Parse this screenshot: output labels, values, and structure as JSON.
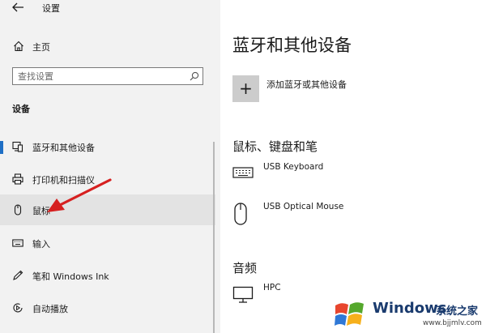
{
  "window": {
    "title": "设置"
  },
  "sidebar": {
    "home_label": "主页",
    "search": {
      "placeholder": "查找设置"
    },
    "section_label": "设备",
    "items": [
      {
        "label": "蓝牙和其他设备",
        "icon": "bluetooth-devices-icon",
        "active": true
      },
      {
        "label": "打印机和扫描仪",
        "icon": "printer-icon",
        "active": false
      },
      {
        "label": "鼠标",
        "icon": "mouse-icon",
        "active": false,
        "hovered": true
      },
      {
        "label": "输入",
        "icon": "keyboard-icon",
        "active": false
      },
      {
        "label": "笔和 Windows Ink",
        "icon": "pen-icon",
        "active": false
      },
      {
        "label": "自动播放",
        "icon": "autoplay-icon",
        "active": false
      }
    ]
  },
  "main": {
    "title": "蓝牙和其他设备",
    "add_device": {
      "icon_glyph": "+",
      "label": "添加蓝牙或其他设备"
    },
    "groups": [
      {
        "title": "鼠标、键盘和笔",
        "devices": [
          {
            "name": "USB Keyboard",
            "icon": "keyboard-icon"
          },
          {
            "name": "USB Optical Mouse",
            "icon": "mouse-icon"
          }
        ]
      },
      {
        "title": "音频",
        "devices": [
          {
            "name": "HPC",
            "icon": "monitor-icon"
          }
        ]
      }
    ]
  },
  "watermark": {
    "brand": "Windows",
    "site": "系统之家",
    "url": "www.bjjmlv.com"
  },
  "colors": {
    "sidebar_bg": "#f2f2f2",
    "accent": "#1f6fc5",
    "hover_bg": "#e3e3e3",
    "annotation_arrow": "#d62020"
  }
}
